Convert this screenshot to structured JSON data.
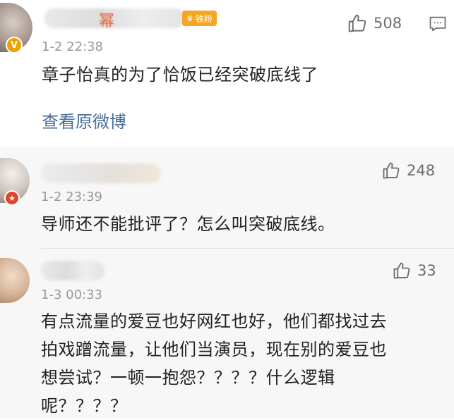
{
  "comments": [
    {
      "username_fragment": "幂",
      "fan_badge": "铁粉",
      "time": "1-2 22:38",
      "likes": "508",
      "text": "章子怡真的为了恰饭已经突破底线了",
      "link": "查看原微博"
    },
    {
      "time": "1-2 23:39",
      "likes": "248",
      "text": "导师还不能批评了？怎么叫突破底线。"
    },
    {
      "time": "1-3 00:33",
      "likes": "33",
      "lines": [
        "有点流量的爱豆也好网红也好，他们都找过去",
        "拍戏蹭流量，让他们当演员，现在别的爱豆也",
        "想尝试？一顿一抱怨？？？？什么逻辑",
        "呢？？？？"
      ]
    }
  ],
  "colors": {
    "link": "#4a6e96",
    "fan_badge": "#f5a623",
    "verified_badge": "#f0a000",
    "sub_background": "#f7f7f7"
  },
  "icons": [
    "thumbs-up-icon",
    "comment-icon",
    "verified-icon"
  ]
}
